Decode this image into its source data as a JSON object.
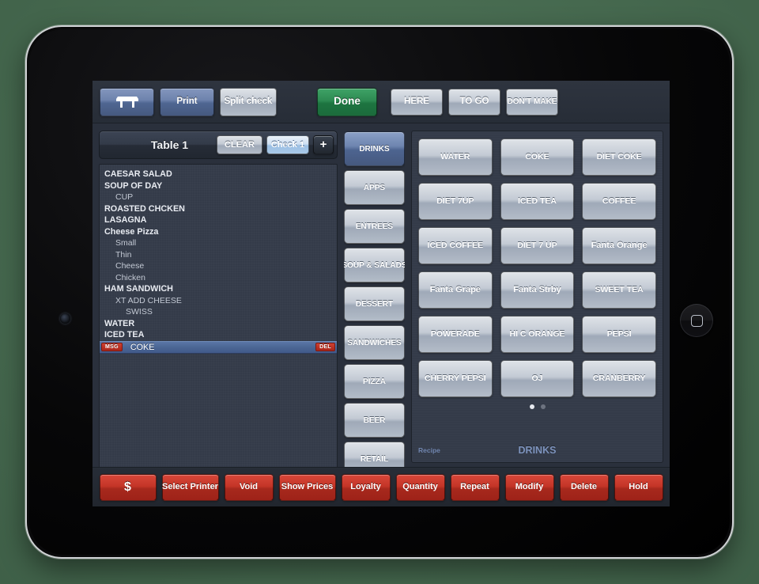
{
  "toolbar": {
    "table_icon": "table-icon",
    "print_label": "Print",
    "split_check_label": "Split check",
    "done_label": "Done",
    "here_label": "HERE",
    "to_go_label": "TO GO",
    "dont_make_label": "DON'T MAKE"
  },
  "check": {
    "table_label": "Table 1",
    "clear_label": "CLEAR",
    "check_tab_label": "Check 1",
    "add_check_label": "+",
    "items": [
      {
        "name": "CAESAR SALAD",
        "level": 0,
        "selected": false
      },
      {
        "name": "SOUP OF DAY",
        "level": 0,
        "selected": false
      },
      {
        "name": "CUP",
        "level": 1,
        "selected": false
      },
      {
        "name": "ROASTED CHCKEN",
        "level": 0,
        "selected": false
      },
      {
        "name": "LASAGNA",
        "level": 0,
        "selected": false
      },
      {
        "name": "Cheese Pizza",
        "level": 0,
        "selected": false
      },
      {
        "name": "Small",
        "level": 1,
        "selected": false
      },
      {
        "name": "Thin",
        "level": 1,
        "selected": false
      },
      {
        "name": "Cheese",
        "level": 1,
        "selected": false
      },
      {
        "name": "Chicken",
        "level": 1,
        "selected": false
      },
      {
        "name": "HAM SANDWICH",
        "level": 0,
        "selected": false
      },
      {
        "name": "XT ADD CHEESE",
        "level": 1,
        "selected": false
      },
      {
        "name": "SWISS",
        "level": 2,
        "selected": false
      },
      {
        "name": "WATER",
        "level": 0,
        "selected": false
      },
      {
        "name": "ICED TEA",
        "level": 0,
        "selected": false
      },
      {
        "name": "COKE",
        "level": 0,
        "selected": true,
        "msg_badge": "MSG",
        "del_badge": "DEL"
      }
    ]
  },
  "categories": {
    "selected": "DRINKS",
    "items": [
      {
        "label": "DRINKS",
        "active": true
      },
      {
        "label": "APPS",
        "active": false
      },
      {
        "label": "ENTREES",
        "active": false
      },
      {
        "label": "SOUP & SALADS",
        "active": false
      },
      {
        "label": "DESSERT",
        "active": false
      },
      {
        "label": "SANDWICHES",
        "active": false
      },
      {
        "label": "PIZZA",
        "active": false
      },
      {
        "label": "BEER",
        "active": false
      },
      {
        "label": "RETAIL",
        "active": false
      }
    ]
  },
  "grid": {
    "products": [
      {
        "label": "WATER",
        "mixedcase": false
      },
      {
        "label": "COKE",
        "mixedcase": false
      },
      {
        "label": "DIET COKE",
        "mixedcase": false
      },
      {
        "label": "DIET 7UP",
        "mixedcase": false
      },
      {
        "label": "ICED TEA",
        "mixedcase": false
      },
      {
        "label": "COFFEE",
        "mixedcase": false
      },
      {
        "label": "ICED COFFEE",
        "mixedcase": false
      },
      {
        "label": "DIET 7 UP",
        "mixedcase": false
      },
      {
        "label": "Fanta Orange",
        "mixedcase": true
      },
      {
        "label": "Fanta Grape",
        "mixedcase": true
      },
      {
        "label": "Fanta Strby",
        "mixedcase": true
      },
      {
        "label": "SWEET TEA",
        "mixedcase": false
      },
      {
        "label": "POWERADE",
        "mixedcase": false
      },
      {
        "label": "HI C ORANGE",
        "mixedcase": false
      },
      {
        "label": "PEPSI",
        "mixedcase": false
      },
      {
        "label": "CHERRY PEPSI",
        "mixedcase": false
      },
      {
        "label": "OJ",
        "mixedcase": false
      },
      {
        "label": "CRANBERRY",
        "mixedcase": false
      }
    ],
    "pages": 2,
    "current_page": 1,
    "recipe_label": "Recipe",
    "category_label": "DRINKS"
  },
  "footer": {
    "actions": [
      {
        "label": "$",
        "size": "money"
      },
      {
        "label": "Select Printer",
        "size": "wide"
      },
      {
        "label": "Void",
        "size": "narrow"
      },
      {
        "label": "Show Prices",
        "size": "wide"
      },
      {
        "label": "Loyalty",
        "size": "narrow"
      },
      {
        "label": "Quantity",
        "size": "narrow"
      },
      {
        "label": "Repeat",
        "size": "narrow"
      },
      {
        "label": "Modify",
        "size": "narrow"
      },
      {
        "label": "Delete",
        "size": "narrow"
      },
      {
        "label": "Hold",
        "size": "narrow"
      }
    ]
  },
  "colors": {
    "backdrop": "#4a7055",
    "panel": "#343b49",
    "accent_blue": "#4f6692",
    "accent_green": "#1d7440",
    "accent_red": "#c43527"
  }
}
